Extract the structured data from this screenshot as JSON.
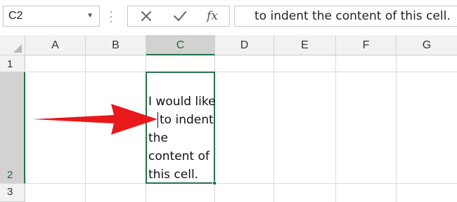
{
  "name_box": {
    "value": "C2"
  },
  "formula_bar": {
    "cancel_icon": "close-icon",
    "enter_icon": "check-icon",
    "function_label": "fx",
    "content": "to indent the content of this cell."
  },
  "columns": [
    "A",
    "B",
    "C",
    "D",
    "E",
    "F",
    "G"
  ],
  "rows": [
    "1",
    "2",
    "3"
  ],
  "active_cell": {
    "ref": "C2",
    "lines": [
      "I would like",
      "to indent",
      "the",
      "content of",
      "this cell."
    ]
  },
  "colors": {
    "accent": "#217346",
    "arrow": "#e8191c"
  }
}
